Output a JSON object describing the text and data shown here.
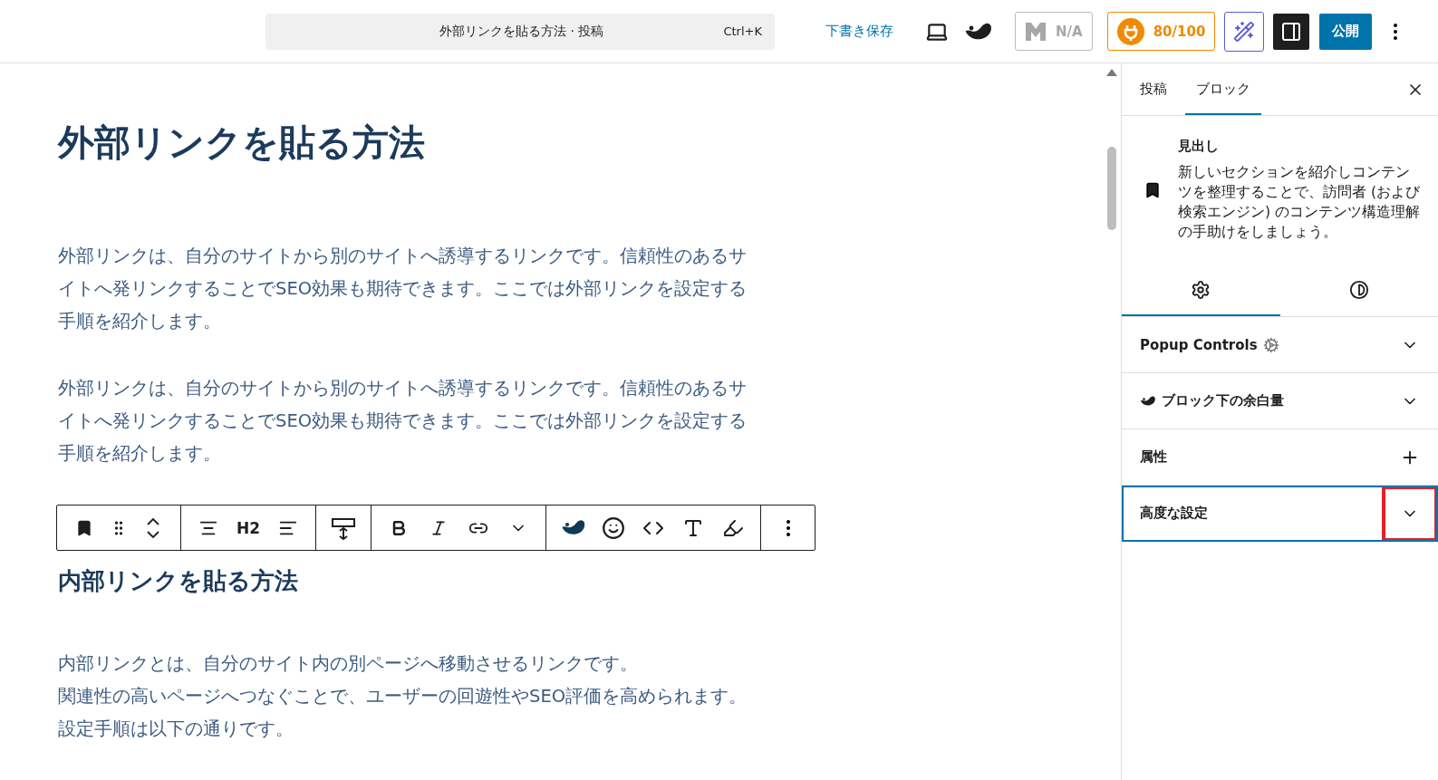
{
  "header": {
    "command_bar": {
      "title": "外部リンクを貼る方法 · 投稿",
      "shortcut": "Ctrl+K"
    },
    "save_draft": "下書き保存",
    "seo_status": "N/A",
    "score": "80/100",
    "sidebar_toggle": {
      "on": true
    },
    "publish": "公開"
  },
  "editor": {
    "title": "外部リンクを貼る方法",
    "blocks": [
      {
        "kind": "paragraph",
        "lines": [
          "外部リンクは、自分のサイトから別のサイトへ誘導するリンクです。信頼性のあるサ",
          "イトへ発リンクすることでSEO効果も期待できます。ここでは外部リンクを設定する",
          "手順を紹介します。"
        ]
      },
      {
        "kind": "paragraph",
        "lines": [
          "外部リンクは、自分のサイトから別のサイトへ誘導するリンクです。信頼性のあるサ",
          "イトへ発リンクすることでSEO効果も期待できます。ここでは外部リンクを設定する",
          "手順を紹介します。"
        ]
      },
      {
        "kind": "toolbar",
        "heading_level": "H2"
      },
      {
        "kind": "heading",
        "text": "内部リンクを貼る方法"
      },
      {
        "kind": "paragraph",
        "lines": [
          "内部リンクとは、自分のサイト内の別ページへ移動させるリンクです。",
          "関連性の高いページへつなぐことで、ユーザーの回遊性やSEO評価を高められます。",
          "設定手順は以下の通りです。"
        ]
      }
    ]
  },
  "sidebar": {
    "tabs": [
      {
        "label": "投稿",
        "selected": false
      },
      {
        "label": "ブロック",
        "selected": true
      }
    ],
    "block_card": {
      "title": "見出し",
      "description": "新しいセクションを紹介しコンテンツを整理することで、訪問者 (および検索エンジン) のコンテンツ構造理解の手助けをしましょう。"
    },
    "subtabs": [
      {
        "kind": "settings",
        "selected": true
      },
      {
        "kind": "styles",
        "selected": false
      }
    ],
    "panels": [
      {
        "title": "Popup Controls",
        "kind": "popup",
        "focused": false,
        "marked": false
      },
      {
        "title": "ブロック下の余白量",
        "kind": "swell",
        "focused": false,
        "marked": false
      },
      {
        "title": "属性",
        "kind": "addable",
        "focused": false,
        "marked": false
      },
      {
        "title": "高度な設定",
        "kind": "plain",
        "focused": true,
        "marked": true
      }
    ]
  }
}
